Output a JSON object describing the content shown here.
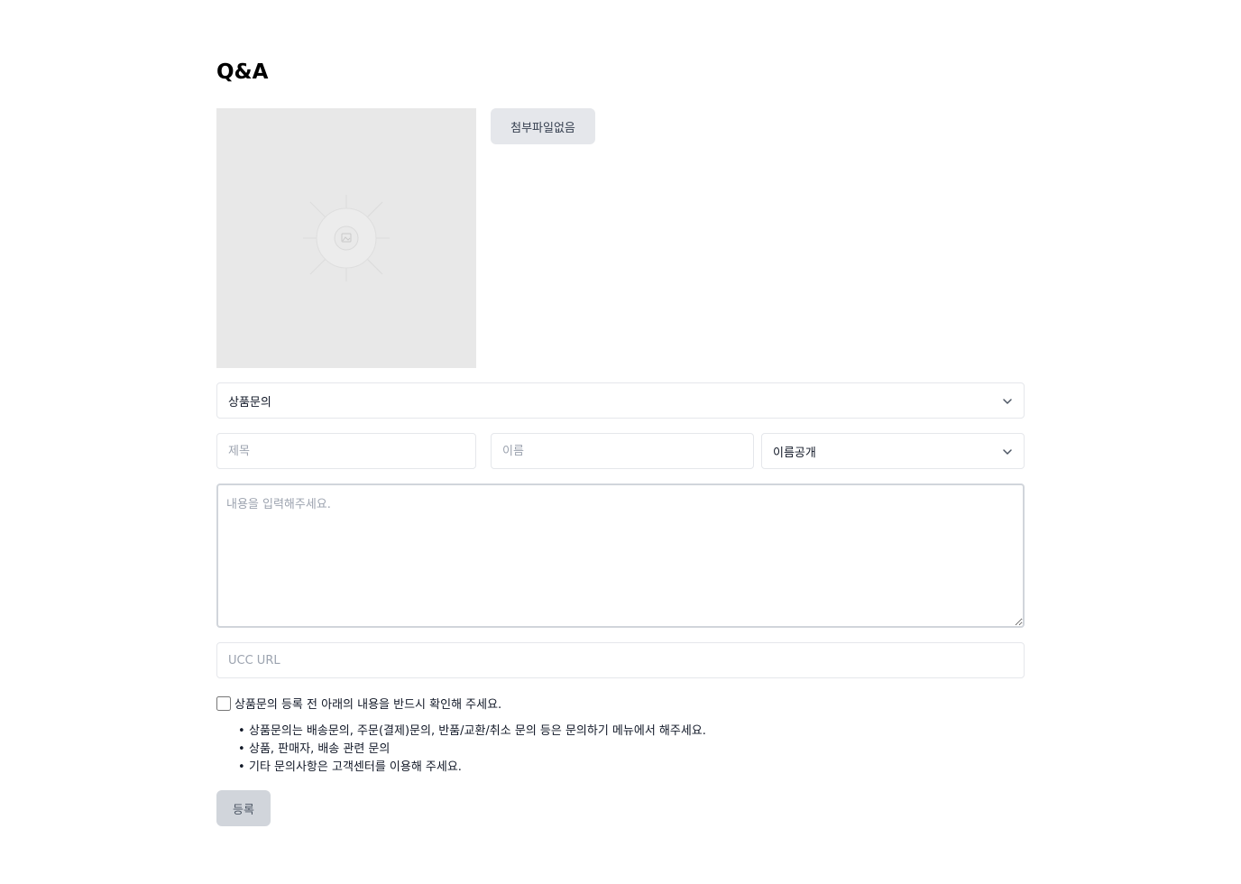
{
  "page": {
    "title": "Q&A"
  },
  "attachment": {
    "button_label": "첨부파일없음",
    "image_icon": "image-placeholder-icon"
  },
  "form": {
    "category": {
      "selected": "상품문의",
      "icon": "chevron-down-icon"
    },
    "subject": {
      "placeholder": "제목"
    },
    "name": {
      "placeholder": "이름"
    },
    "name_visibility": {
      "selected": "이름공개",
      "icon": "chevron-down-icon"
    },
    "content": {
      "placeholder": "내용을 입력해주세요."
    },
    "ucc_url": {
      "placeholder": "UCC URL"
    },
    "agree": {
      "label": "상품문의 등록 전 아래의 내용을 반드시 확인해 주세요."
    },
    "notices": [
      "상품문의는 배송문의, 주문(결제)문의, 반품/교환/취소 문의 등은 문의하기 메뉴에서 해주세요.",
      "상품, 판매자, 배송 관련 문의",
      "기타 문의사항은 고객센터를 이용해 주세요."
    ],
    "bullet": "•",
    "submit_label": "등록"
  },
  "colors": {
    "border": "#e5e7eb",
    "button_bg": "#e5e7eb",
    "submit_bg": "#d1d5db",
    "placeholder": "#9ca3af"
  }
}
